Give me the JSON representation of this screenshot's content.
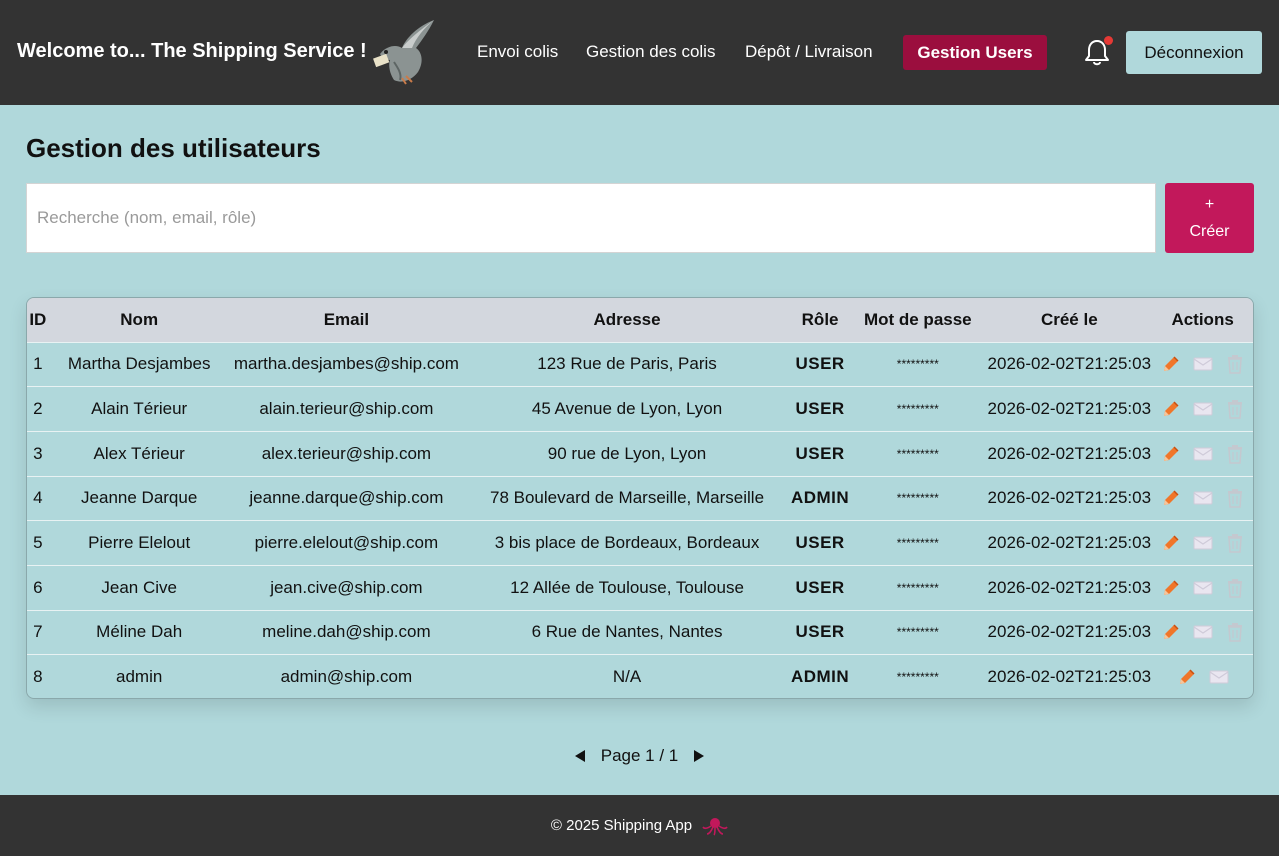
{
  "header": {
    "brand": "Welcome to... The Shipping Service !",
    "nav": [
      {
        "label": "Envoi colis"
      },
      {
        "label": "Gestion des colis"
      },
      {
        "label": "Dépôt / Livraison"
      }
    ],
    "active_nav": "Gestion Users",
    "logout_label": "Déconnexion",
    "has_notification": true
  },
  "main": {
    "title": "Gestion des utilisateurs",
    "search_placeholder": "Recherche (nom, email, rôle)",
    "create_plus": "+",
    "create_label": "Créer"
  },
  "table": {
    "columns": [
      "ID",
      "Nom",
      "Email",
      "Adresse",
      "Rôle",
      "Mot de passe",
      "Créé le",
      "Actions"
    ],
    "rows": [
      {
        "id": "1",
        "nom": "Martha Desjambes",
        "email": "martha.desjambes@ship.com",
        "adresse": "123 Rue de Paris, Paris",
        "role": "USER",
        "password": "*********",
        "created": "2026-02-02T21:25:03"
      },
      {
        "id": "2",
        "nom": "Alain Térieur",
        "email": "alain.terieur@ship.com",
        "adresse": "45 Avenue de Lyon, Lyon",
        "role": "USER",
        "password": "*********",
        "created": "2026-02-02T21:25:03"
      },
      {
        "id": "3",
        "nom": "Alex Térieur",
        "email": "alex.terieur@ship.com",
        "adresse": "90 rue de Lyon, Lyon",
        "role": "USER",
        "password": "*********",
        "created": "2026-02-02T21:25:03"
      },
      {
        "id": "4",
        "nom": "Jeanne Darque",
        "email": "jeanne.darque@ship.com",
        "adresse": "78 Boulevard de Marseille, Marseille",
        "role": "ADMIN",
        "password": "*********",
        "created": "2026-02-02T21:25:03"
      },
      {
        "id": "5",
        "nom": "Pierre Elelout",
        "email": "pierre.elelout@ship.com",
        "adresse": "3 bis place de Bordeaux, Bordeaux",
        "role": "USER",
        "password": "*********",
        "created": "2026-02-02T21:25:03"
      },
      {
        "id": "6",
        "nom": "Jean Cive",
        "email": "jean.cive@ship.com",
        "adresse": "12 Allée de Toulouse, Toulouse",
        "role": "USER",
        "password": "*********",
        "created": "2026-02-02T21:25:03"
      },
      {
        "id": "7",
        "nom": "Méline Dah",
        "email": "meline.dah@ship.com",
        "adresse": "6 Rue de Nantes, Nantes",
        "role": "USER",
        "password": "*********",
        "created": "2026-02-02T21:25:03"
      },
      {
        "id": "8",
        "nom": "admin",
        "email": "admin@ship.com",
        "adresse": "N/A",
        "role": "ADMIN",
        "password": "*********",
        "created": "2026-02-02T21:25:03",
        "no_delete": true
      }
    ]
  },
  "pager": {
    "text": "Page 1 / 1"
  },
  "footer": {
    "text": "© 2025 Shipping App"
  },
  "colors": {
    "header_bg": "#333333",
    "page_bg": "#b0d8db",
    "accent": "#c2185b",
    "active_nav": "#9b0e3e",
    "edit_icon": "#f0762a"
  }
}
